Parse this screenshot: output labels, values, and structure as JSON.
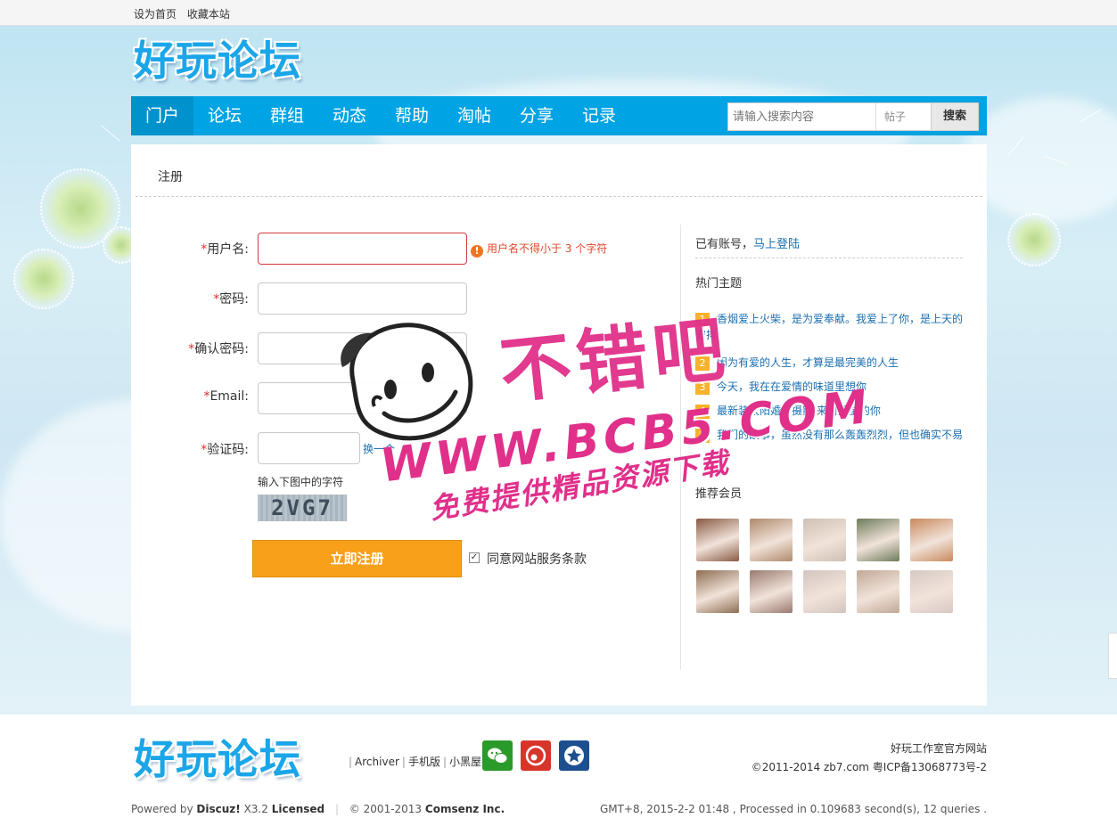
{
  "topbar": {
    "set_home": "设为首页",
    "bookmark": "收藏本站"
  },
  "logo": {
    "text": "好玩论坛"
  },
  "nav": {
    "items": [
      "门户",
      "论坛",
      "群组",
      "动态",
      "帮助",
      "淘帖",
      "分享",
      "记录"
    ],
    "active_index": 0,
    "search_placeholder": "请输入搜索内容",
    "search_type": "帖子",
    "search_button": "搜索"
  },
  "register": {
    "title": "注册",
    "username_label": "用户名:",
    "username_error": "用户名不得小于 3 个字符",
    "password_label": "密码:",
    "confirm_label": "确认密码:",
    "email_label": "Email:",
    "captcha_label": "验证码:",
    "captcha_refresh": "换一个",
    "captcha_hint": "输入下图中的字符",
    "captcha_text": "2VG7",
    "submit": "立即注册",
    "agree": "同意网站服务条款",
    "required_mark": "*"
  },
  "side": {
    "have_account": "已有账号，",
    "login_link": "马上登陆",
    "hot_title": "热门主题",
    "hot_items": [
      {
        "num": "1",
        "text": "香烟爱上火柴，是为爱奉献。我爱上了你，是上天的安排"
      },
      {
        "num": "2",
        "text": "因为有爱的人生，才算是最完美的人生"
      },
      {
        "num": "3",
        "text": "今天，我在在爱情的味道里想你"
      },
      {
        "num": "4",
        "text": "最新装太阳婚纱摄影 来自星星的你"
      },
      {
        "num": "5",
        "text": "我们的故事，虽然没有那么轰轰烈烈，但也确实不易"
      }
    ],
    "members_title": "推荐会员",
    "avatar_colors": [
      "#8a5a44",
      "#b08a6c",
      "#cfc0b4",
      "#6e7c5c",
      "#c98a5e",
      "#8e6e52",
      "#9a7a70",
      "#d4c4c0",
      "#c0a896",
      "#d8c8c4"
    ]
  },
  "watermark": {
    "line1": "不错吧",
    "line2": "WWW.BCB5.COM",
    "line3": "免费提供精品资源下载"
  },
  "footer": {
    "logo": "好玩论坛",
    "links": [
      "Archiver",
      "手机版",
      "小黑屋"
    ],
    "site_name": "好玩工作室官方网站",
    "copyright": "©2011-2014 zb7.com 粤ICP备13068773号-2",
    "powered_prefix": "Powered by",
    "powered_name": "Discuz!",
    "powered_version": "X3.2",
    "licensed": "Licensed",
    "comsenz_years": "© 2001-2013",
    "comsenz": "Comsenz Inc.",
    "runtime": "GMT+8, 2015-2-2 01:48 , Processed in 0.109683 second(s), 12 queries ."
  },
  "colors": {
    "nav": "#00a3e3",
    "submit": "#f9a01b",
    "link": "#1a6fb0",
    "error": "#e04a2a",
    "watermark": "#e0308a"
  }
}
